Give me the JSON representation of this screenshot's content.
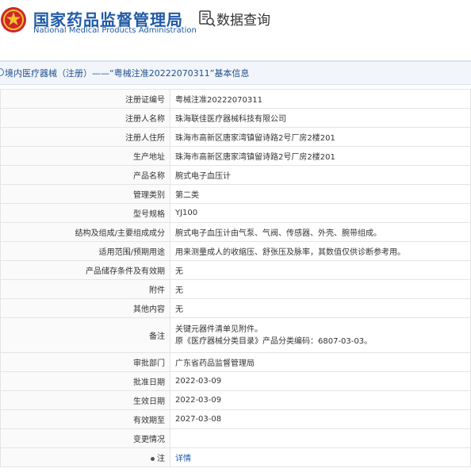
{
  "header": {
    "org_name_cn": "国家药品监督管理局",
    "org_name_en": "National Medical Products Administration",
    "query_title": "数据查询"
  },
  "title_bar": {
    "text": "境内医疗器械（注册）——“粤械注准20222070311”基本信息"
  },
  "rows": [
    {
      "label": "注册证编号",
      "value": "粤械注准20222070311"
    },
    {
      "label": "注册人名称",
      "value": "珠海联佳医疗器械科技有限公司"
    },
    {
      "label": "注册人住所",
      "value": "珠海市高新区唐家湾镇留诗路2号厂房2楼201"
    },
    {
      "label": "生产地址",
      "value": "珠海市高新区唐家湾镇留诗路2号厂房2楼201"
    },
    {
      "label": "产品名称",
      "value": "腕式电子血压计"
    },
    {
      "label": "管理类别",
      "value": "第二类"
    },
    {
      "label": "型号规格",
      "value": "YJ100"
    },
    {
      "label": "结构及组成/主要组成成分",
      "value": "腕式电子血压计由气泵、气阀、传感器、外壳、腕带组成。"
    },
    {
      "label": "适用范围/预期用途",
      "value": "用来测量成人的收缩压、舒张压及脉率，其数值仅供诊断参考用。"
    },
    {
      "label": "产品储存条件及有效期",
      "value": "无"
    },
    {
      "label": "附件",
      "value": "无"
    },
    {
      "label": "其他内容",
      "value": "无"
    },
    {
      "label": "备注",
      "value_line1": "关键元器件清单见附件。",
      "value_line2": "原《医疗器械分类目录》产品分类编码：6807-03-03。"
    },
    {
      "label": "审批部门",
      "value": "广东省药品监督管理局"
    },
    {
      "label": "批准日期",
      "value": "2022-03-09"
    },
    {
      "label": "生效日期",
      "value": "2022-03-09"
    },
    {
      "label": "有效期至",
      "value": "2027-03-08"
    },
    {
      "label": "变更情况",
      "value": ""
    },
    {
      "label": "注",
      "value": "详情"
    }
  ]
}
